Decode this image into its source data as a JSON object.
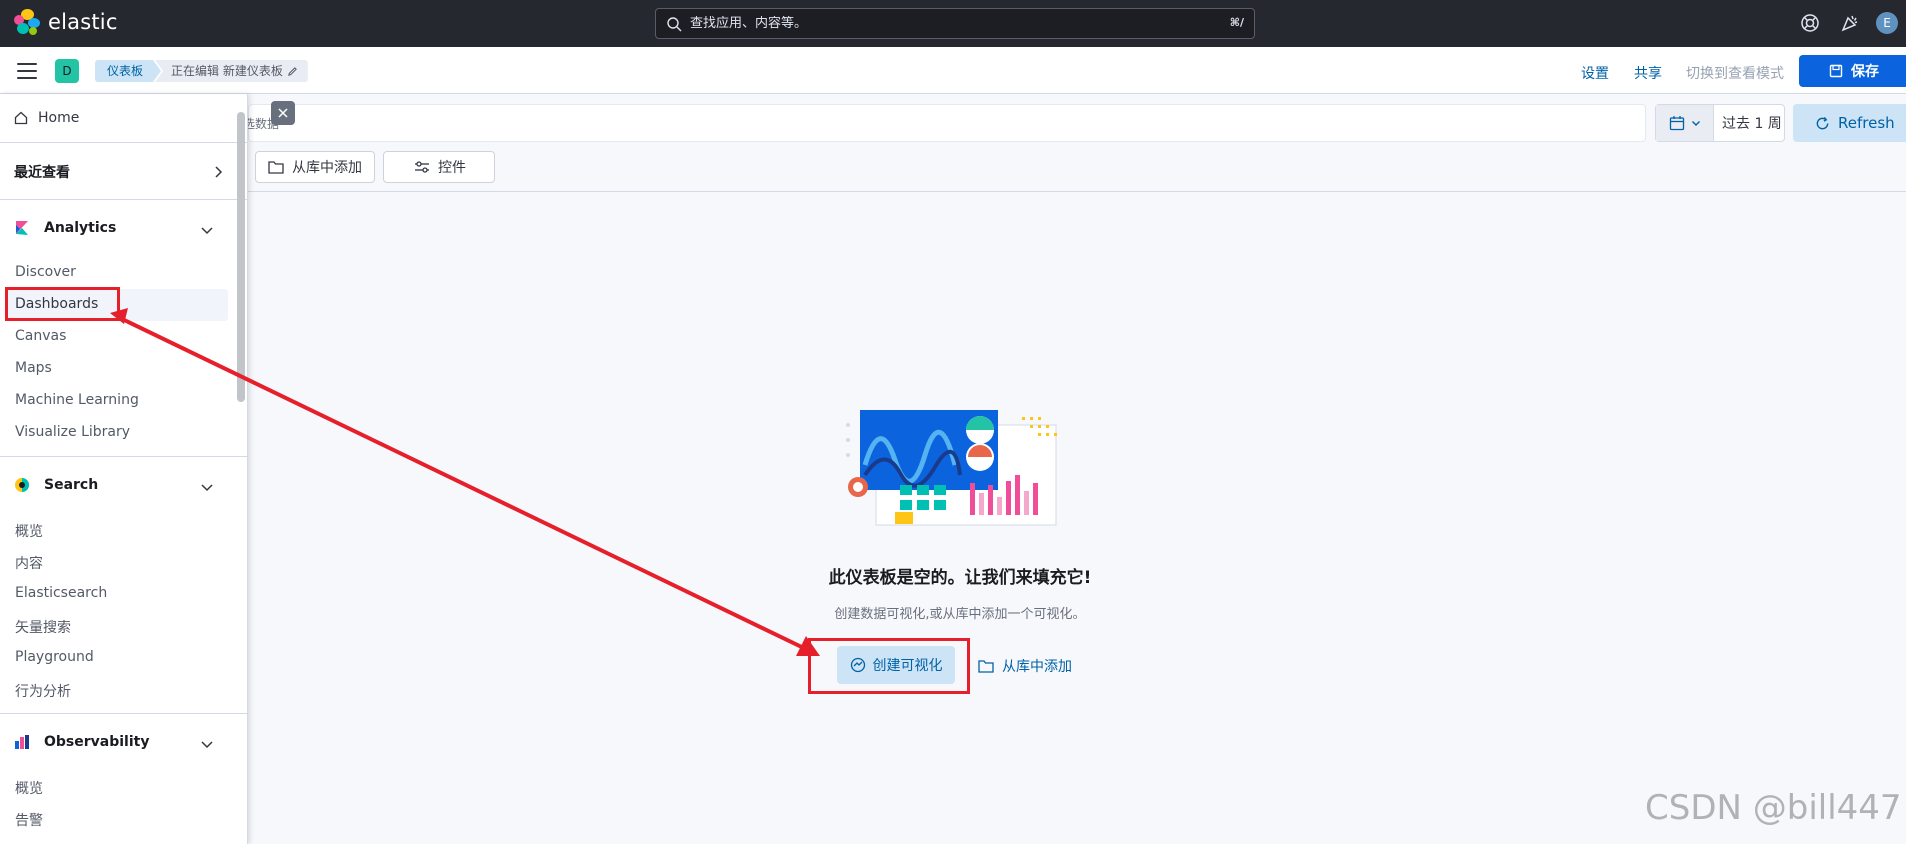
{
  "header": {
    "brand": "elastic",
    "search_placeholder": "查找应用、内容等。",
    "search_shortcut": "⌘/",
    "avatar_initial": "E"
  },
  "subbar": {
    "space_initial": "D",
    "breadcrumbs": [
      "仪表板",
      "正在编辑 新建仪表板"
    ],
    "links": {
      "settings": "设置",
      "share": "共享",
      "switch_view": "切换到查看模式"
    },
    "save_label": "保存"
  },
  "query": {
    "partial_text": "选数据",
    "date_value": "过去 1 周",
    "refresh_label": "Refresh"
  },
  "toolbar": {
    "add_from_library": "从库中添加",
    "controls": "控件"
  },
  "empty_state": {
    "title": "此仪表板是空的。让我们来填充它!",
    "description": "创建数据可视化,或从库中添加一个可视化。",
    "create_button": "创建可视化",
    "library_link": "从库中添加"
  },
  "nav": {
    "home": "Home",
    "recent": "最近查看",
    "groups": [
      {
        "title": "Analytics",
        "items": [
          "Discover",
          "Dashboards",
          "Canvas",
          "Maps",
          "Machine Learning",
          "Visualize Library"
        ]
      },
      {
        "title": "Search",
        "items": [
          "概览",
          "内容",
          "Elasticsearch",
          "矢量搜索",
          "Playground",
          "行为分析"
        ]
      },
      {
        "title": "Observability",
        "items": [
          "概览",
          "告警"
        ]
      }
    ],
    "active_item": "Dashboards"
  },
  "watermark": "CSDN @bill447",
  "colors": {
    "header_bg": "#25282f",
    "primary": "#0b64dd",
    "link": "#0061a6",
    "annotation": "#e5202a"
  }
}
